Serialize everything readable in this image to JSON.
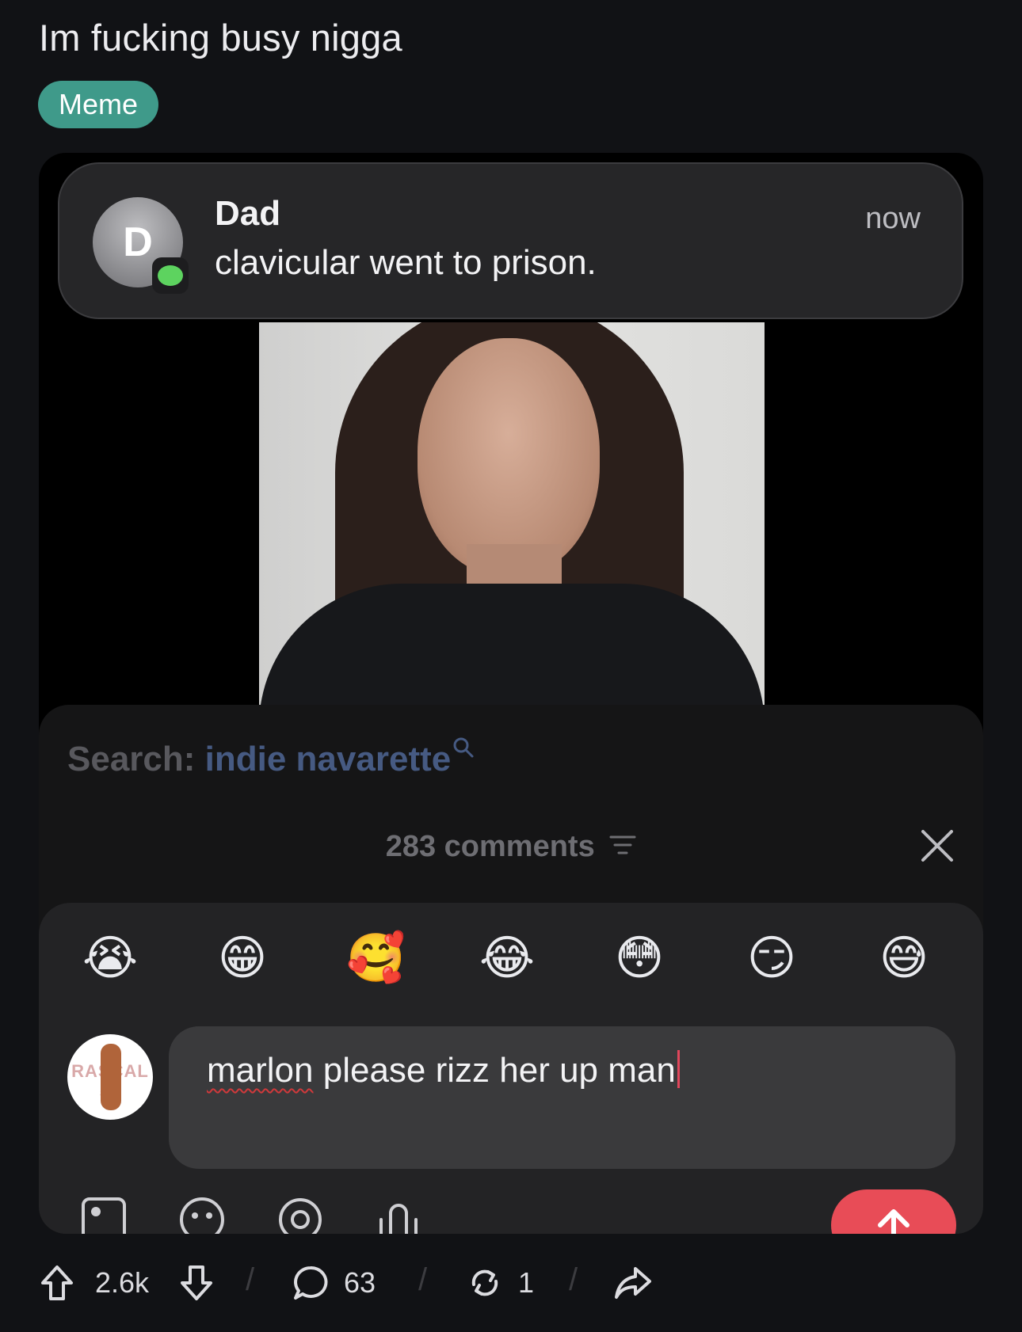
{
  "post": {
    "title": "Im fucking busy nigga",
    "flair": "Meme"
  },
  "notification": {
    "avatar_letter": "D",
    "sender": "Dad",
    "message": "clavicular went to prison.",
    "time": "now",
    "app_icon": "messages-icon"
  },
  "search": {
    "label": "Search:",
    "term": "indie navarette",
    "icon": "search-icon"
  },
  "comments": {
    "count_label": "283 comments",
    "filter_icon": "filter-icon",
    "close_icon": "close-icon"
  },
  "emojis": [
    "😭",
    "😁",
    "🥰",
    "😂",
    "😳",
    "😏",
    "😅"
  ],
  "composer": {
    "avatar_text": "RASCAL 51",
    "draft_misspelled": "marlon",
    "draft_rest": " please rizz her up man",
    "tools": [
      "image-icon",
      "emoji-icon",
      "mention-icon",
      "audio-icon"
    ],
    "send_icon": "arrow-up-icon"
  },
  "actions": {
    "upvotes": "2.6k",
    "comments": "63",
    "reposts": "1"
  },
  "colors": {
    "background": "#111215",
    "flair": "#3f9a8a",
    "send": "#e84c57",
    "search_term": "#465a82"
  }
}
